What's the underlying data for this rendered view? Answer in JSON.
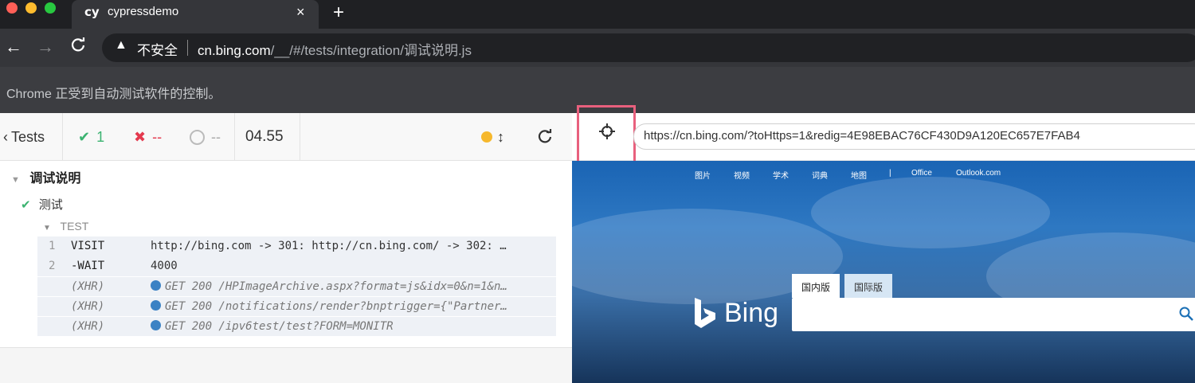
{
  "browser": {
    "tab_favicon": "cy",
    "tab_title": "cypressdemo",
    "tab_close": "×",
    "new_tab": "+",
    "security_label": "不安全",
    "url_host": "cn.bing.com",
    "url_path": "/__/#/tests/integration/调试说明.js",
    "automation_notice": "Chrome 正受到自动测试软件的控制。",
    "colors": {
      "close": "#ff5f57",
      "minimize": "#febc2e",
      "maximize": "#28c840"
    }
  },
  "reporter": {
    "back_label": "Tests",
    "passed": "1",
    "failed": "--",
    "pending": "--",
    "duration": "04.55",
    "suite_title": "调试说明",
    "test_title": "测试",
    "hook_title": "TEST",
    "commands": [
      {
        "num": "1",
        "name": "VISIT",
        "message": "http://bing.com -> 301: http://cn.bing.com/ -> 302: …"
      },
      {
        "num": "2",
        "name": "-WAIT",
        "message": "4000"
      },
      {
        "num": "",
        "name": "(XHR)",
        "message": "GET 200 /HPImageArchive.aspx?format=js&idx=0&n=1&n…"
      },
      {
        "num": "",
        "name": "(XHR)",
        "message": "GET 200 /notifications/render?bnptrigger={\"Partner…"
      },
      {
        "num": "",
        "name": "(XHR)",
        "message": "GET 200 /ipv6test/test?FORM=MONITR"
      }
    ]
  },
  "aut": {
    "url": "https://cn.bing.com/?toHttps=1&redig=4E98EBAC76CF430D9A120EC657E7FAB4",
    "nav": [
      "图片",
      "视频",
      "学术",
      "词典",
      "地图",
      "|",
      "Office",
      "Outlook.com"
    ],
    "logo_text": "Bing",
    "tabs": [
      "国内版",
      "国际版"
    ]
  }
}
